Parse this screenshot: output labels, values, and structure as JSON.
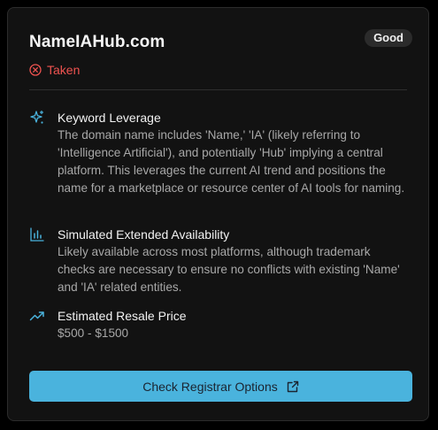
{
  "domain": {
    "name": "NameIAHub.com",
    "rating": "Good",
    "status": "Taken"
  },
  "features": [
    {
      "icon": "sparkles-icon",
      "title": "Keyword Leverage",
      "description": "The domain name includes 'Name,' 'IA' (likely referring to 'Intelligence Artificial'), and potentially 'Hub' implying a central platform. This leverages the current AI trend and positions the name for a marketplace or resource center of AI tools for naming."
    },
    {
      "icon": "bar-chart-icon",
      "title": "Simulated Extended Availability",
      "description": "Likely available across most platforms, although trademark checks are necessary to ensure no conflicts with existing 'Name' and 'IA' related entities."
    },
    {
      "icon": "trending-up-icon",
      "title": "Estimated Resale Price",
      "description": "$500 - $1500"
    }
  ],
  "cta": {
    "label": "Check Registrar Options",
    "icon": "external-link-icon"
  },
  "colors": {
    "accent": "#4ab3dd",
    "taken": "#ef5350",
    "card_bg": "#121212",
    "icon": "#4ab3dd"
  }
}
